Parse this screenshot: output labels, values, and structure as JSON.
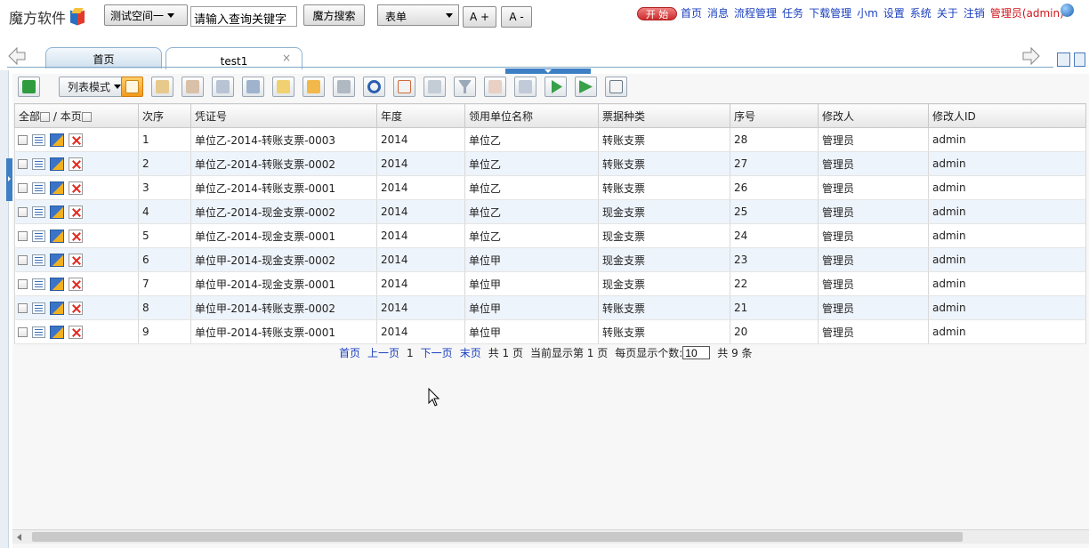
{
  "header": {
    "logo_text": "魔方软件",
    "workspace_button": "测试空间一",
    "search_placeholder": "请输入查询关键字",
    "search_button": "魔方搜索",
    "form_select": "表单",
    "font_increase": "A +",
    "font_decrease": "A -",
    "start_badge": "开 始",
    "nav": [
      "首页",
      "消息",
      "流程管理",
      "任务",
      "下载管理",
      "小m",
      "设置",
      "系统",
      "关于",
      "注销"
    ],
    "user": "管理员(admin)"
  },
  "tabs": {
    "home": "首页",
    "active": "test1",
    "close_glyph": "×"
  },
  "toolbar": {
    "mode_label": "列表模式"
  },
  "grid": {
    "select_all_label": "全部",
    "page_label": "/ 本页",
    "columns": [
      "次序",
      "凭证号",
      "年度",
      "领用单位名称",
      "票据种类",
      "序号",
      "修改人",
      "修改人ID"
    ],
    "rows": [
      [
        "1",
        "单位乙-2014-转账支票-0003",
        "2014",
        "单位乙",
        "转账支票",
        "28",
        "管理员",
        "admin"
      ],
      [
        "2",
        "单位乙-2014-转账支票-0002",
        "2014",
        "单位乙",
        "转账支票",
        "27",
        "管理员",
        "admin"
      ],
      [
        "3",
        "单位乙-2014-转账支票-0001",
        "2014",
        "单位乙",
        "转账支票",
        "26",
        "管理员",
        "admin"
      ],
      [
        "4",
        "单位乙-2014-现金支票-0002",
        "2014",
        "单位乙",
        "现金支票",
        "25",
        "管理员",
        "admin"
      ],
      [
        "5",
        "单位乙-2014-现金支票-0001",
        "2014",
        "单位乙",
        "现金支票",
        "24",
        "管理员",
        "admin"
      ],
      [
        "6",
        "单位甲-2014-现金支票-0002",
        "2014",
        "单位甲",
        "现金支票",
        "23",
        "管理员",
        "admin"
      ],
      [
        "7",
        "单位甲-2014-现金支票-0001",
        "2014",
        "单位甲",
        "现金支票",
        "22",
        "管理员",
        "admin"
      ],
      [
        "8",
        "单位甲-2014-转账支票-0002",
        "2014",
        "单位甲",
        "转账支票",
        "21",
        "管理员",
        "admin"
      ],
      [
        "9",
        "单位甲-2014-转账支票-0001",
        "2014",
        "单位甲",
        "转账支票",
        "20",
        "管理员",
        "admin"
      ]
    ]
  },
  "pager": {
    "first": "首页",
    "prev": "上一页",
    "current": "1",
    "next": "下一页",
    "last": "末页",
    "total_pages": "共 1 页",
    "showing": "当前显示第 1 页",
    "per_page_label": "每页显示个数:",
    "per_page_value": "10",
    "total_records": "共 9 条"
  },
  "colors": {
    "accent_blue": "#3d7fc4",
    "link_blue": "#1a3fbf",
    "user_red": "#d0161b",
    "start_red": "#cc2a2a",
    "row_alt": "#eef4fb"
  },
  "icons": {
    "toolbar": [
      "refresh-icon",
      "add-icon",
      "edit-icon",
      "copy-icon",
      "print-icon",
      "export-icon",
      "note-icon",
      "report-icon",
      "calendar-icon",
      "reload-icon",
      "view-icon",
      "filter-clear-icon",
      "filter-icon",
      "chart-icon",
      "image-icon",
      "play-icon",
      "flag-icon",
      "settings-icon"
    ],
    "row": [
      "detail-icon",
      "edit-icon",
      "delete-icon"
    ]
  }
}
